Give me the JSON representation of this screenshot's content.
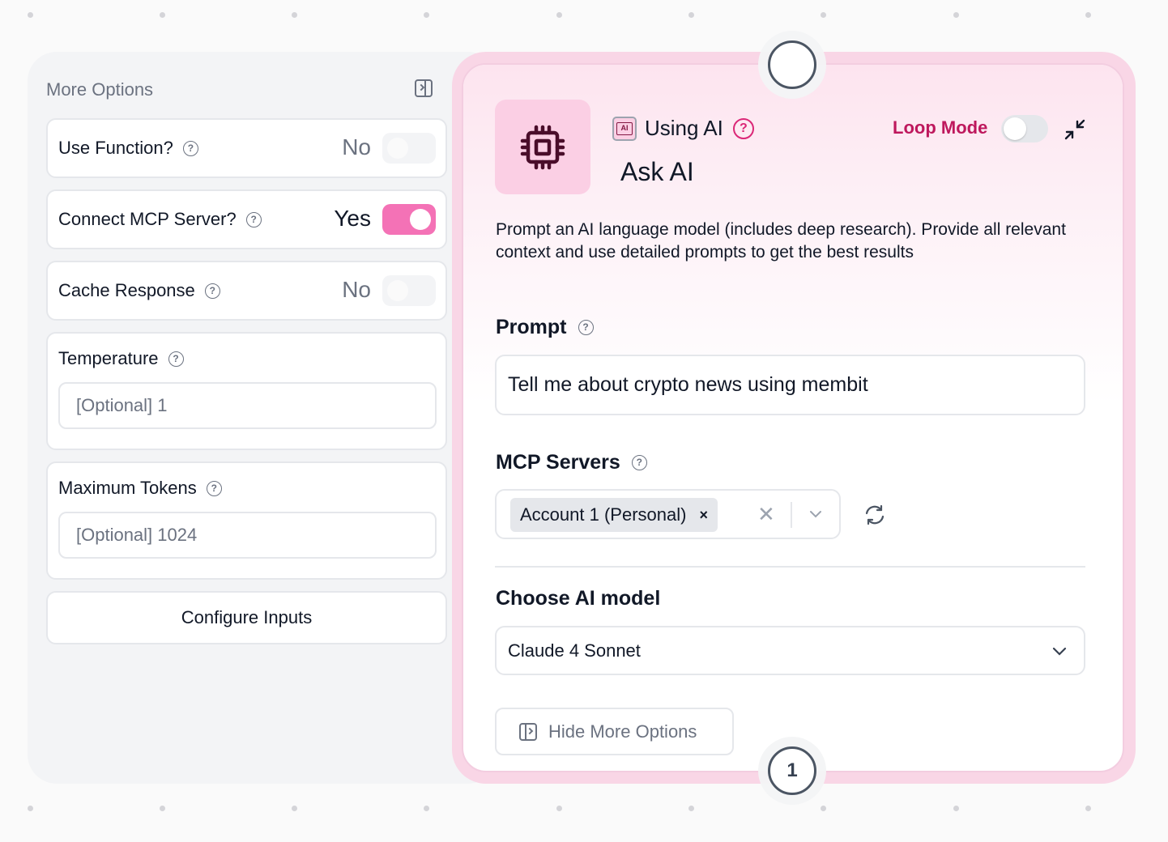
{
  "more_options": {
    "title": "More Options",
    "use_function": {
      "label": "Use Function?",
      "value": "No",
      "enabled": false
    },
    "connect_mcp": {
      "label": "Connect MCP Server?",
      "value": "Yes",
      "enabled": true
    },
    "cache_response": {
      "label": "Cache Response",
      "value": "No",
      "enabled": false
    },
    "temperature": {
      "label": "Temperature",
      "placeholder": "[Optional] 1"
    },
    "max_tokens": {
      "label": "Maximum Tokens",
      "placeholder": "[Optional] 1024"
    },
    "configure_inputs": "Configure Inputs"
  },
  "node": {
    "badge": "AI",
    "using_label": "Using AI",
    "help_glyph": "?",
    "title": "Ask AI",
    "loop_mode_label": "Loop Mode",
    "loop_mode_enabled": false,
    "description": "Prompt an AI language model (includes deep research). Provide all relevant context and use detailed prompts to get the best results",
    "prompt": {
      "label": "Prompt",
      "value": "Tell me about crypto news using membit"
    },
    "mcp_servers": {
      "label": "MCP Servers",
      "selected": [
        "Account 1 (Personal)"
      ],
      "tag_remove": "×",
      "clear": "✕"
    },
    "model": {
      "label": "Choose AI model",
      "value": "Claude 4 Sonnet"
    },
    "hide_more_options": "Hide More Options",
    "output_connector": "1",
    "accent_color": "#be185d",
    "toggle_on_color": "#f472b6"
  }
}
